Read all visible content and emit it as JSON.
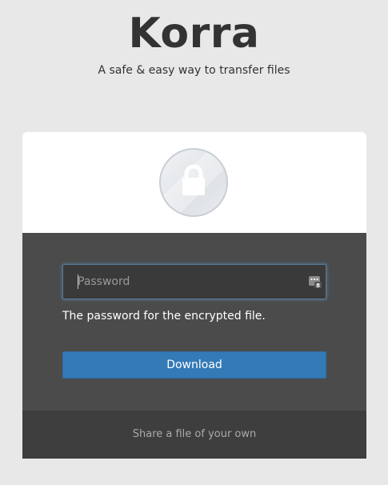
{
  "header": {
    "title": "Korra",
    "tagline": "A safe & easy way to transfer files"
  },
  "card": {
    "lock_icon": "lock-icon",
    "password": {
      "placeholder": "Password",
      "value": "",
      "key_icon": "password-manager-icon"
    },
    "help_text": "The password for the encrypted file.",
    "download_label": "Download",
    "footer_link": "Share a file of your own"
  },
  "colors": {
    "page_background": "#e8e8e8",
    "card_dark": "#4b4b4b",
    "footer_dark": "#3e3e3e",
    "primary_button": "#337ab7"
  }
}
